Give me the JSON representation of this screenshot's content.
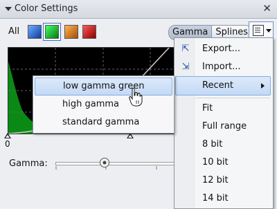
{
  "panel": {
    "title": "Color Settings",
    "close_glyph": "✕",
    "all_label": "All",
    "swatches": [
      {
        "name": "blue",
        "color": "#1a5fd6"
      },
      {
        "name": "green",
        "color": "#10c020",
        "selected": true
      },
      {
        "name": "orange",
        "color": "#e07a10"
      },
      {
        "name": "red",
        "color": "#d01010"
      }
    ],
    "toggles": [
      {
        "label": "Gamma",
        "active": true
      },
      {
        "label": "Splines",
        "active": false
      }
    ],
    "zero_label": "0",
    "gamma_label": "Gamma:",
    "gamma_slider_fraction": 0.4
  },
  "context_menu": {
    "items": [
      {
        "label": "Export...",
        "icon": "export-icon"
      },
      {
        "label": "Import...",
        "icon": "import-icon"
      },
      {
        "label": "Recent",
        "has_submenu": true,
        "highlight": true
      },
      {
        "label": "Fit"
      },
      {
        "label": "Full range"
      },
      {
        "label": "8 bit"
      },
      {
        "label": "10 bit"
      },
      {
        "label": "12 bit"
      },
      {
        "label": "14 bit"
      }
    ]
  },
  "recent_submenu": {
    "items": [
      {
        "label": "low gamma green",
        "highlight": true
      },
      {
        "label": "high gamma"
      },
      {
        "label": "standard gamma"
      }
    ]
  },
  "colors": {
    "highlight": "#c3d9f5",
    "curve": "#d0d0d0",
    "histogram": "#0a8a14"
  }
}
